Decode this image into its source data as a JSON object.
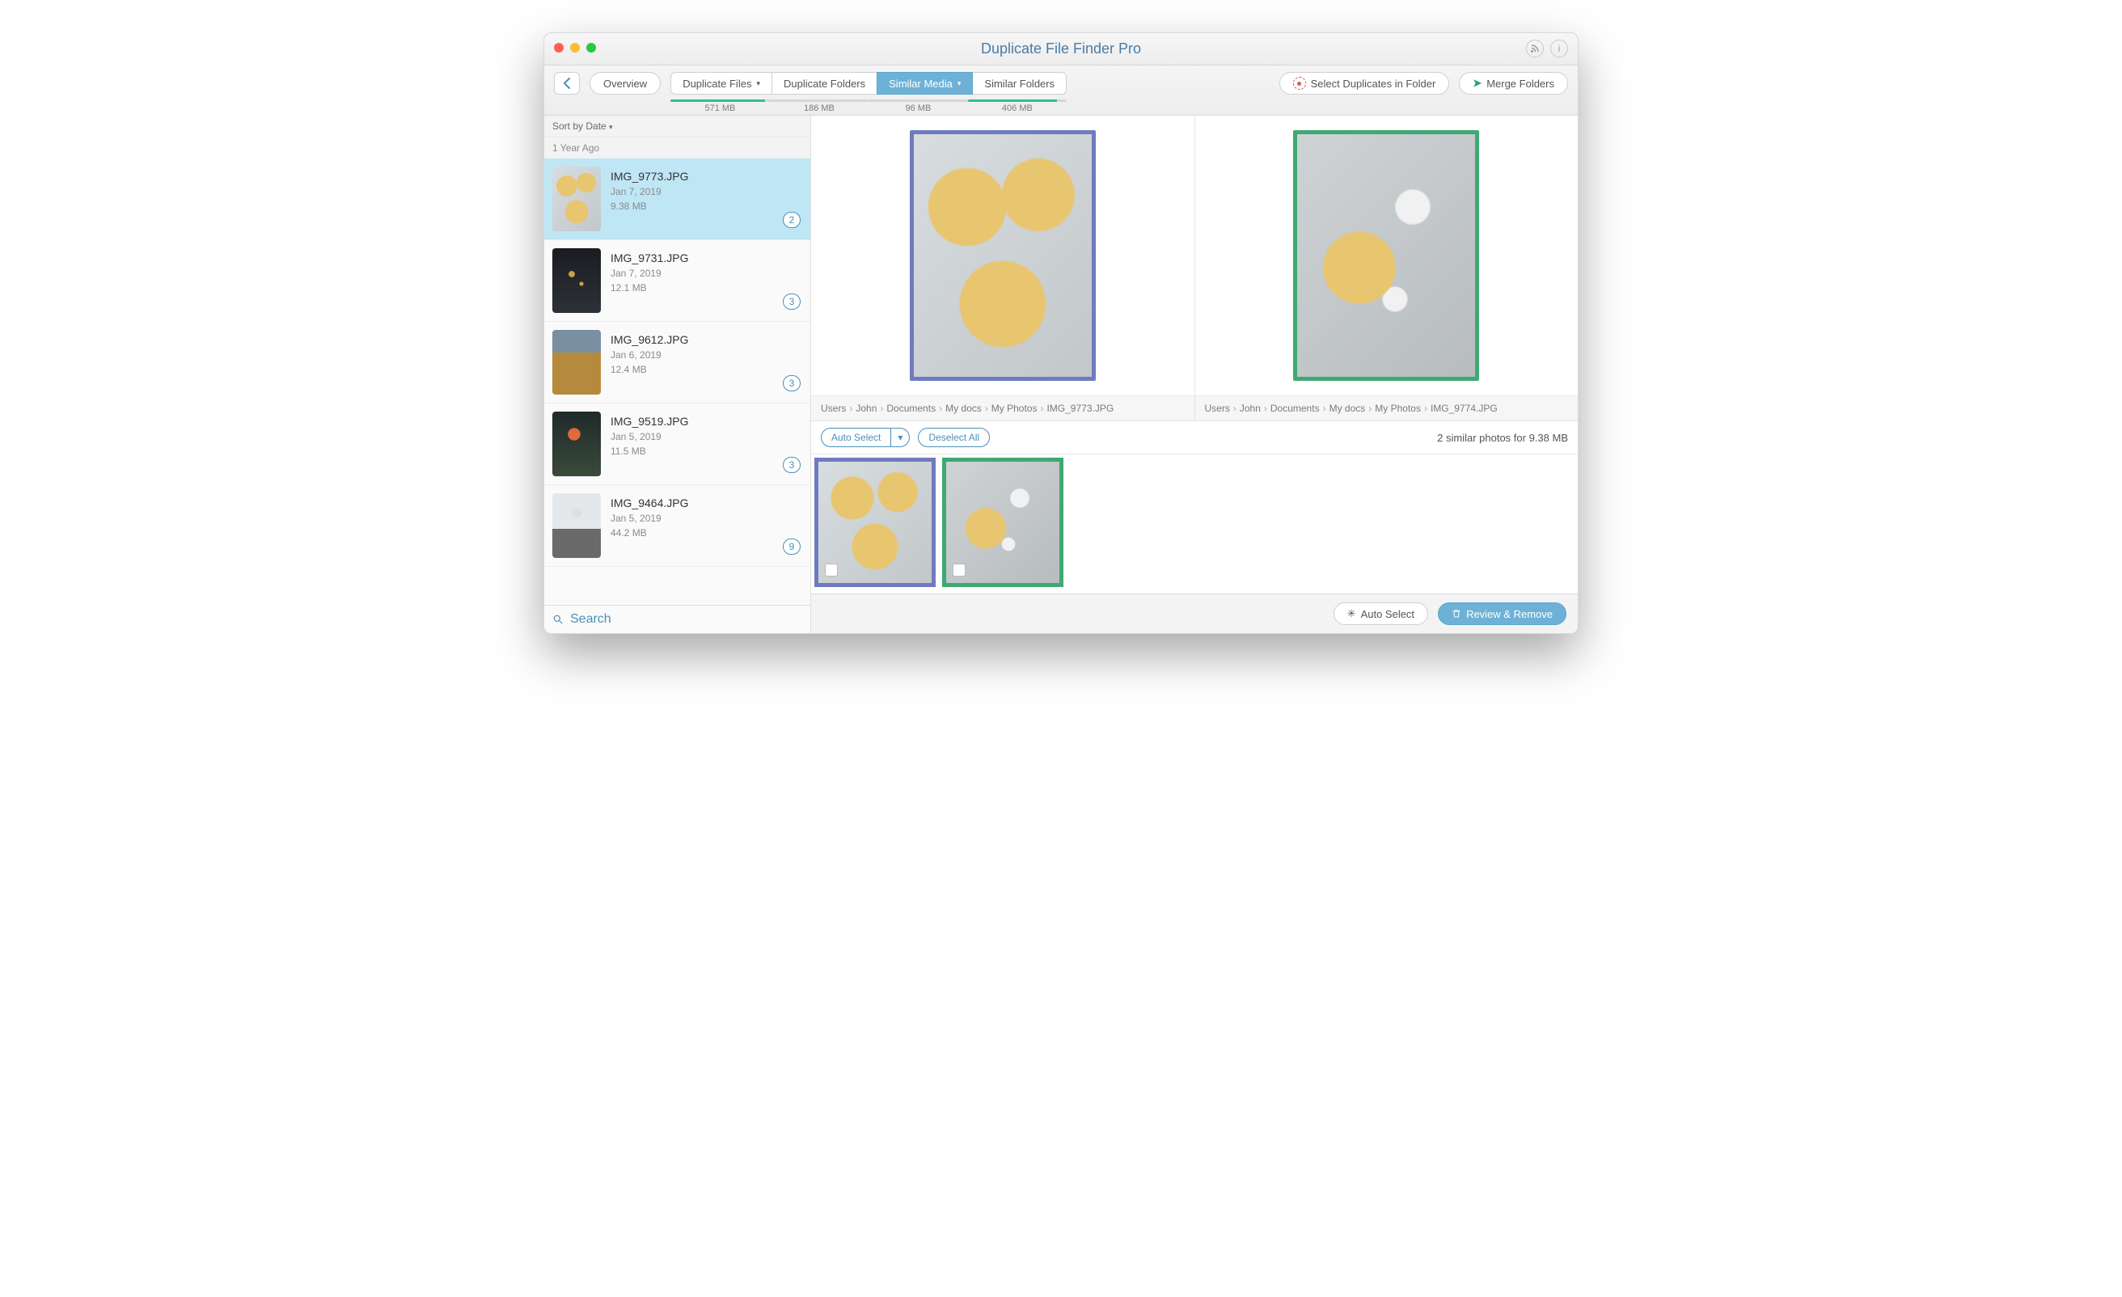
{
  "title": "Duplicate File Finder Pro",
  "toolbar": {
    "overview": "Overview",
    "select_in_folder": "Select Duplicates in Folder",
    "merge_folders": "Merge Folders"
  },
  "tabs": [
    {
      "label": "Duplicate Files",
      "size": "571 MB",
      "fill": 95,
      "dropdown": true
    },
    {
      "label": "Duplicate Folders",
      "size": "186 MB",
      "fill": 0
    },
    {
      "label": "Similar Media",
      "size": "96 MB",
      "fill": 0,
      "active": true,
      "dropdown": true
    },
    {
      "label": "Similar Folders",
      "size": "406 MB",
      "fill": 90
    }
  ],
  "sidebar": {
    "sort": "Sort by Date",
    "group": "1 Year Ago",
    "search": "Search",
    "items": [
      {
        "name": "IMG_9773.JPG",
        "date": "Jan 7, 2019",
        "size": "9.38 MB",
        "count": "2",
        "selected": true,
        "thumb": "ph-cookies"
      },
      {
        "name": "IMG_9731.JPG",
        "date": "Jan 7, 2019",
        "size": "12.1 MB",
        "count": "3",
        "thumb": "ph-dark"
      },
      {
        "name": "IMG_9612.JPG",
        "date": "Jan 6, 2019",
        "size": "12.4 MB",
        "count": "3",
        "thumb": "ph-wheat"
      },
      {
        "name": "IMG_9519.JPG",
        "date": "Jan 5, 2019",
        "size": "11.5 MB",
        "count": "3",
        "thumb": "ph-flower"
      },
      {
        "name": "IMG_9464.JPG",
        "date": "Jan 5, 2019",
        "size": "44.2 MB",
        "count": "9",
        "thumb": "ph-tree"
      }
    ]
  },
  "preview": {
    "left_path": [
      "Users",
      "John",
      "Documents",
      "My docs",
      "My Photos",
      "IMG_9773.JPG"
    ],
    "right_path": [
      "Users",
      "John",
      "Documents",
      "My docs",
      "My Photos",
      "IMG_9774.JPG"
    ]
  },
  "controls": {
    "auto_select": "Auto Select",
    "deselect_all": "Deselect All",
    "summary": "2 similar photos for 9.38 MB"
  },
  "footer": {
    "auto_select": "Auto Select",
    "review_remove": "Review & Remove"
  }
}
